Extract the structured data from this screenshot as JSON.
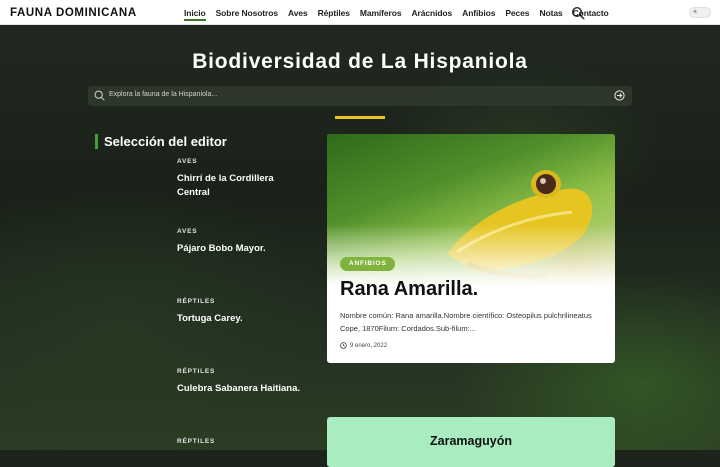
{
  "header": {
    "logo": "FAUNA DOMINICANA",
    "nav": [
      {
        "label": "Inicio",
        "active": true
      },
      {
        "label": "Sobre Nosotros"
      },
      {
        "label": "Aves"
      },
      {
        "label": "Réptiles"
      },
      {
        "label": "Mamíferos"
      },
      {
        "label": "Arácnidos"
      },
      {
        "label": "Anfibios"
      },
      {
        "label": "Peces"
      },
      {
        "label": "Notas"
      },
      {
        "label": "Contacto"
      }
    ],
    "search_icon": "search-icon",
    "theme_icon": "sun-icon"
  },
  "hero": {
    "title": "Biodiversidad de La Hispaniola",
    "search_placeholder": "Explora la fauna de la Hispaniola..."
  },
  "editor": {
    "section_title": "Selección del editor",
    "picks": [
      {
        "category": "AVES",
        "title": "Chirrí de la Cordillera Central"
      },
      {
        "category": "AVES",
        "title": "Pájaro Bobo Mayor."
      },
      {
        "category": "RÉPTILES",
        "title": "Tortuga Carey."
      },
      {
        "category": "RÉPTILES",
        "title": "Culebra Sabanera Haitiana."
      },
      {
        "category": "RÉPTILES",
        "title": ""
      }
    ]
  },
  "feature": {
    "badge": "ANFIBIOS",
    "title": "Rana Amarilla.",
    "excerpt": "Nombre común: Rana amarilla.Nombre científico: Osteopilus pulchrilineatus Cope, 1870Filum: Cordados.Sub-filum:...",
    "date": "9 enero, 2022"
  },
  "second_card": {
    "title": "Zaramaguyón"
  },
  "colors": {
    "accent": "#e8c42a",
    "brand_green": "#3fa03a",
    "badge": "#7fb33d",
    "card2_bg": "#a9ecc0"
  }
}
